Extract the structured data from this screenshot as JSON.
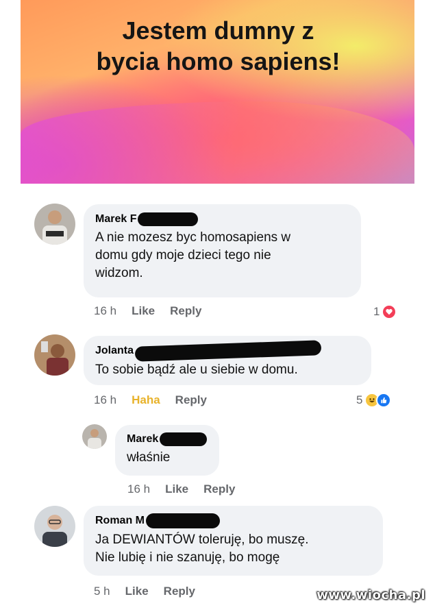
{
  "post": {
    "text_line1": "Jestem dumny z",
    "text_line2": "bycia homo sapiens!"
  },
  "comments": [
    {
      "author": "Marek F",
      "text": "A nie mozesz byc homosapiens w\ndomu gdy moje dzieci tego nie\nwidzom.",
      "time": "16 h",
      "like_label": "Like",
      "reply_label": "Reply",
      "reaction_count": "1",
      "reaction_icon": "love-icon"
    },
    {
      "author": "Jolanta",
      "text": "To sobie bądź ale u siebie w domu.",
      "time": "16 h",
      "like_label": "Haha",
      "reply_label": "Reply",
      "reaction_count": "5",
      "reaction_icons": [
        "haha-icon",
        "like-icon"
      ]
    },
    {
      "author": "Marek",
      "text": "właśnie",
      "time": "16 h",
      "like_label": "Like",
      "reply_label": "Reply"
    },
    {
      "author": "Roman M",
      "text": "Ja DEWIANTÓW toleruję, bo muszę.\nNie lubię i nie szanuję, bo mogę",
      "time": "5 h",
      "like_label": "Like",
      "reply_label": "Reply"
    }
  ],
  "watermark": "www.wiocha.pl",
  "colors": {
    "bubble": "#f0f2f5",
    "meta_text": "#65676b",
    "haha_active": "#e8b22a",
    "love": "#f33e58",
    "like": "#1877f2"
  }
}
